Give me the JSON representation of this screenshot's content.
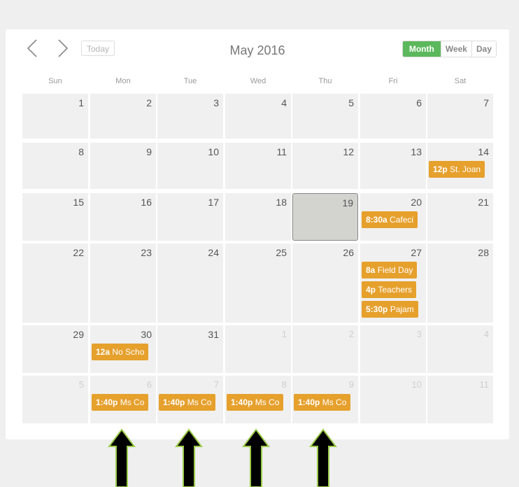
{
  "toolbar": {
    "prev_icon": "chevron-left-icon",
    "next_icon": "chevron-right-icon",
    "today_label": "Today",
    "title": "May 2016",
    "views": [
      {
        "label": "Month",
        "active": true
      },
      {
        "label": "Week",
        "active": false
      },
      {
        "label": "Day",
        "active": false
      }
    ]
  },
  "weekdays": [
    "Sun",
    "Mon",
    "Tue",
    "Wed",
    "Thu",
    "Fri",
    "Sat"
  ],
  "weeks": [
    {
      "days": [
        {
          "num": "1"
        },
        {
          "num": "2"
        },
        {
          "num": "3"
        },
        {
          "num": "4"
        },
        {
          "num": "5"
        },
        {
          "num": "6"
        },
        {
          "num": "7"
        }
      ]
    },
    {
      "days": [
        {
          "num": "8"
        },
        {
          "num": "9"
        },
        {
          "num": "10"
        },
        {
          "num": "11"
        },
        {
          "num": "12"
        },
        {
          "num": "13"
        },
        {
          "num": "14",
          "events": [
            {
              "time": "12p",
              "title": "St. Joan"
            }
          ]
        }
      ]
    },
    {
      "days": [
        {
          "num": "15"
        },
        {
          "num": "16"
        },
        {
          "num": "17"
        },
        {
          "num": "18"
        },
        {
          "num": "19",
          "today": true
        },
        {
          "num": "20",
          "events": [
            {
              "time": "8:30a",
              "title": "Cafeci"
            }
          ]
        },
        {
          "num": "21"
        }
      ]
    },
    {
      "days": [
        {
          "num": "22"
        },
        {
          "num": "23"
        },
        {
          "num": "24"
        },
        {
          "num": "25"
        },
        {
          "num": "26"
        },
        {
          "num": "27",
          "events": [
            {
              "time": "8a",
              "title": "Field Day"
            },
            {
              "time": "4p",
              "title": "Teachers"
            },
            {
              "time": "5:30p",
              "title": "Pajam"
            }
          ]
        },
        {
          "num": "28"
        }
      ]
    },
    {
      "days": [
        {
          "num": "29"
        },
        {
          "num": "30",
          "events": [
            {
              "time": "12a",
              "title": "No Scho"
            }
          ]
        },
        {
          "num": "31"
        },
        {
          "num": "1",
          "other": true
        },
        {
          "num": "2",
          "other": true
        },
        {
          "num": "3",
          "other": true
        },
        {
          "num": "4",
          "other": true
        }
      ]
    },
    {
      "days": [
        {
          "num": "5",
          "other": true
        },
        {
          "num": "6",
          "other": true,
          "events": [
            {
              "time": "1:40p",
              "title": "Ms Co"
            }
          ]
        },
        {
          "num": "7",
          "other": true,
          "events": [
            {
              "time": "1:40p",
              "title": "Ms Co"
            }
          ]
        },
        {
          "num": "8",
          "other": true,
          "events": [
            {
              "time": "1:40p",
              "title": "Ms Co"
            }
          ]
        },
        {
          "num": "9",
          "other": true,
          "events": [
            {
              "time": "1:40p",
              "title": "Ms Co"
            }
          ]
        },
        {
          "num": "10",
          "other": true
        },
        {
          "num": "11",
          "other": true
        }
      ]
    }
  ],
  "colors": {
    "event": "#e6a02c",
    "active_view": "#5cb85c",
    "today_cell": "#d3d3cf",
    "arrow_fill": "#000000",
    "arrow_outline": "#9ccc4c"
  },
  "annotation_arrows": [
    "up-arrow-icon",
    "up-arrow-icon",
    "up-arrow-icon",
    "up-arrow-icon"
  ]
}
